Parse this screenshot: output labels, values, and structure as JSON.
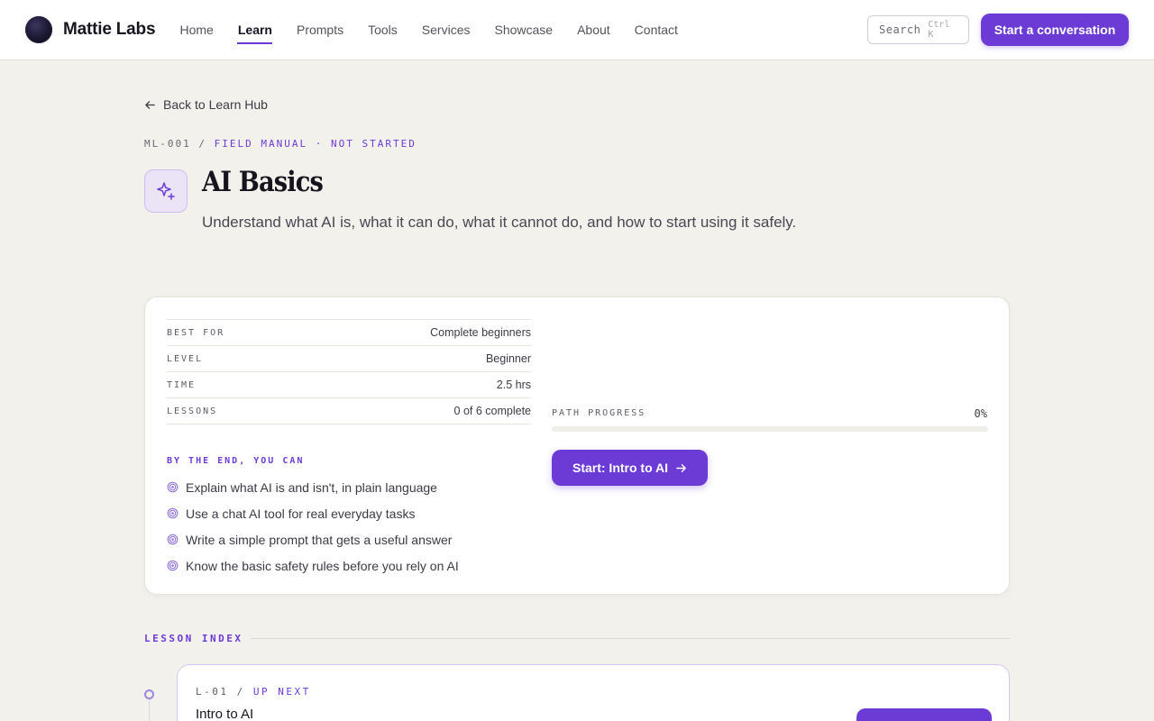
{
  "brand": {
    "name": "Mattie Labs"
  },
  "nav": {
    "items": [
      {
        "label": "Home",
        "active": false
      },
      {
        "label": "Learn",
        "active": true
      },
      {
        "label": "Prompts",
        "active": false
      },
      {
        "label": "Tools",
        "active": false
      },
      {
        "label": "Services",
        "active": false
      },
      {
        "label": "Showcase",
        "active": false
      },
      {
        "label": "About",
        "active": false
      },
      {
        "label": "Contact",
        "active": false
      }
    ]
  },
  "search": {
    "label": "Search",
    "shortcut": "Ctrl K"
  },
  "header_cta": {
    "label": "Start a conversation"
  },
  "back_link": {
    "label": "Back to Learn Hub",
    "icon": "arrow-left-icon"
  },
  "hero": {
    "eyebrow_code": "ML-001",
    "eyebrow_separator": "/",
    "eyebrow_tag": "FIELD MANUAL · NOT STARTED",
    "icon": "sparkle-icon",
    "title": "AI Basics",
    "subtitle": "Understand what AI is, what it can do, what it cannot do, and how to start using it safely."
  },
  "meta": [
    {
      "label": "BEST FOR",
      "value": "Complete beginners"
    },
    {
      "label": "LEVEL",
      "value": "Beginner"
    },
    {
      "label": "TIME",
      "value": "2.5 hrs"
    },
    {
      "label": "LESSONS",
      "value": "0 of 6 complete"
    }
  ],
  "outcomes": {
    "title": "BY THE END, YOU CAN",
    "icon": "target-icon",
    "items": [
      "Explain what AI is and isn't, in plain language",
      "Use a chat AI tool for real everyday tasks",
      "Write a simple prompt that gets a useful answer",
      "Know the basic safety rules before you rely on AI"
    ]
  },
  "progress": {
    "label": "PATH PROGRESS",
    "value_text": "0%",
    "percent": 0
  },
  "start_cta": {
    "label": "Start: Intro to AI",
    "icon": "arrow-right-icon"
  },
  "lesson_index": {
    "label": "LESSON INDEX",
    "lessons": [
      {
        "code": "L-01",
        "separator": "/",
        "status": "UP NEXT",
        "title": "Intro to AI"
      }
    ]
  },
  "colors": {
    "accent": "#6c3bd6",
    "background": "#f3f1ec",
    "card": "#ffffff"
  }
}
